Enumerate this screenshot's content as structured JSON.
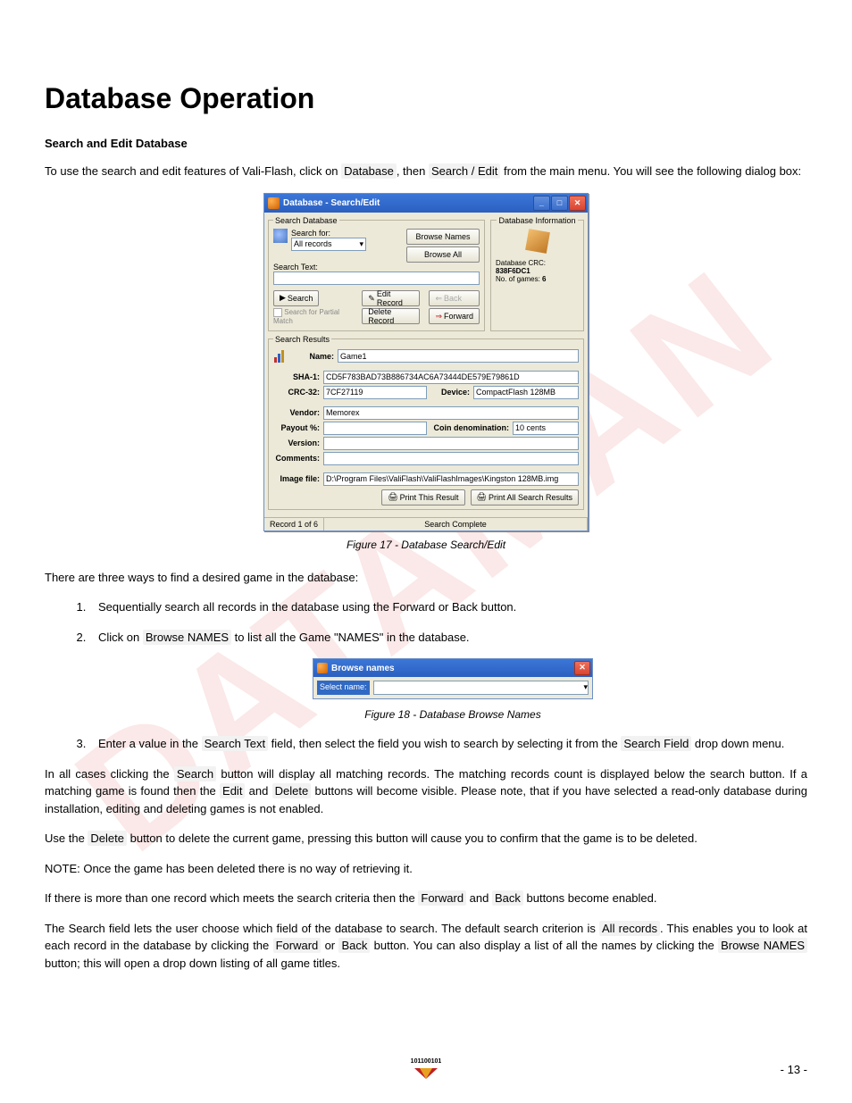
{
  "watermark": "DATAMAN",
  "title": "Database Operation",
  "subtitle": "Search and Edit Database",
  "intro": {
    "p1a": "To use the search and edit features of Vali-Flash, click on ",
    "hi1": "Database",
    "p1b": ", then ",
    "hi2": "Search / Edit",
    "p1c": " from the main menu. You will see the following dialog box:"
  },
  "dialog1": {
    "title": "Database - Search/Edit",
    "searchdb": "Search Database",
    "searchfor": "Search for:",
    "searchfor_val": "All records",
    "searchtext": "Search Text:",
    "browse_names": "Browse Names",
    "browse_all": "Browse All",
    "search_btn": "Search",
    "partial": "Search for Partial Match",
    "edit_record": "Edit Record",
    "delete_record": "Delete Record",
    "back": "Back",
    "forward": "Forward",
    "dbinfo": "Database Information",
    "dbcrc_l": "Database CRC:",
    "dbcrc_v": "838F6DC1",
    "nog_l": "No. of games:",
    "nog_v": "6",
    "results": "Search Results",
    "name_l": "Name:",
    "name_v": "Game1",
    "sha1_l": "SHA-1:",
    "sha1_v": "CD5F783BAD73B886734AC6A73444DE579E79861D",
    "crc32_l": "CRC-32:",
    "crc32_v": "7CF27119",
    "device_l": "Device:",
    "device_v": "CompactFlash 128MB",
    "vendor_l": "Vendor:",
    "vendor_v": "Memorex",
    "payout_l": "Payout %:",
    "coin_l": "Coin denomination:",
    "coin_v": "10 cents",
    "version_l": "Version:",
    "comments_l": "Comments:",
    "image_l": "Image file:",
    "image_v": "D:\\Program Files\\ValiFlash\\ValiFlashImages\\Kingston 128MB.img",
    "print_this": "Print This Result",
    "print_all": "Print All Search Results",
    "status_rec": "Record 1 of 6",
    "status_msg": "Search Complete"
  },
  "caption1": "Figure 17 - Database Search/Edit",
  "p_find": "There are three ways to find a desired game in the database:",
  "li1": "Sequentially search all records in the database using the Forward or Back button.",
  "li2a": "Click on ",
  "li2hi": "Browse NAMES",
  "li2b": " to list all the Game \"NAMES\" in the database.",
  "dialog2": {
    "title": "Browse names",
    "label": "Select name:"
  },
  "caption2": "Figure 18 - Database Browse Names",
  "li3a": "Enter a value in the ",
  "li3hi1": "Search Text",
  "li3b": " field, then select the field you wish to search by selecting it from the ",
  "li3hi2": "Search Field",
  "li3c": " drop down menu.",
  "p4a": "In all cases clicking the ",
  "p4hi1": "Search",
  "p4b": " button will display all matching records. The matching records count is displayed below the search button. If a matching game is found then the ",
  "p4hi2": "Edit",
  "p4c": " and ",
  "p4hi3": "Delete",
  "p4d": " buttons will become visible. Please note, that if you have selected a read-only database during installation, editing and deleting games is not enabled.",
  "p5a": "Use the ",
  "p5hi": "Delete",
  "p5b": " button to delete the current game, pressing this button will cause you to confirm that the game is to be deleted.",
  "p6": "NOTE: Once the game has been deleted there is no way of retrieving it.",
  "p7a": "If there is more than one record which meets the search criteria then the ",
  "p7hi1": "Forward",
  "p7b": " and ",
  "p7hi2": "Back",
  "p7c": " buttons become enabled.",
  "p8a": "The Search field lets the user choose which field of the database to search. The default search criterion is ",
  "p8hi1": "All records",
  "p8b": ". This enables you to look at each record in the database by clicking the ",
  "p8hi2": "Forward",
  "p8c": " or ",
  "p8hi3": "Back",
  "p8d": " button. You can also display a list of all the names by clicking the ",
  "p8hi4": "Browse NAMES",
  "p8e": " button; this will open a drop down listing of all game titles.",
  "page_num": "- 13 -"
}
